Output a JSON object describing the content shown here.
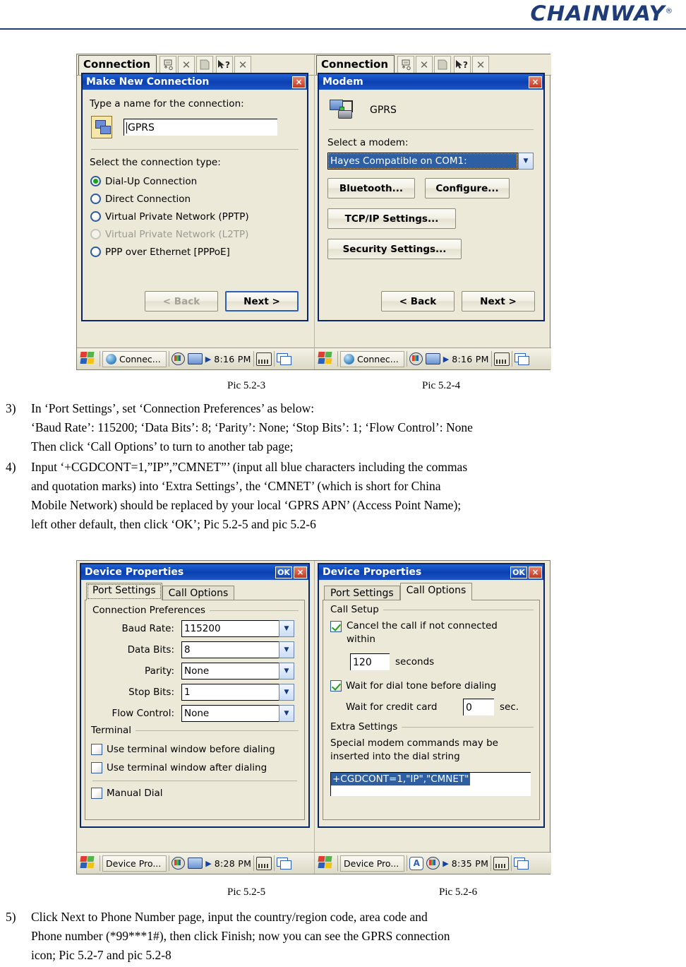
{
  "header": {
    "brand": "CHAINWAY",
    "registered": "®"
  },
  "figures": {
    "top": {
      "left": {
        "shell": {
          "title": "Connection",
          "buttons": [
            "upload-icon",
            "delete-icon",
            "properties-icon",
            "help-icon",
            "close-icon"
          ]
        },
        "dialog": {
          "title": "Make New Connection",
          "close_label": "×",
          "name_prompt": "Type a name for the connection:",
          "name_value": "GPRS",
          "type_prompt": "Select the connection type:",
          "options": [
            {
              "label": "Dial-Up Connection",
              "selected": true,
              "disabled": false
            },
            {
              "label": "Direct Connection",
              "selected": false,
              "disabled": false
            },
            {
              "label": "Virtual Private Network (PPTP)",
              "selected": false,
              "disabled": false
            },
            {
              "label": "Virtual Private Network (L2TP)",
              "selected": false,
              "disabled": true
            },
            {
              "label": "PPP over Ethernet [PPPoE]",
              "selected": false,
              "disabled": false
            }
          ],
          "back_label": "< Back",
          "next_label": "Next >"
        },
        "taskbar": {
          "item": "Connec...",
          "time": "8:16 PM"
        }
      },
      "right": {
        "shell": {
          "title": "Connection",
          "buttons": [
            "upload-icon",
            "delete-icon",
            "properties-icon",
            "help-icon",
            "close-icon"
          ]
        },
        "dialog": {
          "title": "Modem",
          "close_label": "×",
          "connection_name": "GPRS",
          "modem_prompt": "Select a modem:",
          "modem_value": "Hayes Compatible on COM1:",
          "bluetooth_label": "Bluetooth...",
          "configure_label": "Configure...",
          "tcpip_label": "TCP/IP Settings...",
          "security_label": "Security Settings...",
          "back_label": "< Back",
          "next_label": "Next >"
        },
        "taskbar": {
          "item": "Connec...",
          "time": "8:16 PM"
        }
      },
      "caption_left": "Pic 5.2-3",
      "caption_right": "Pic 5.2-4"
    },
    "bottom": {
      "left": {
        "dialog": {
          "title": "Device Properties",
          "ok_label": "OK",
          "close_label": "×",
          "tabs": [
            {
              "label": "Port Settings",
              "active": true
            },
            {
              "label": "Call Options",
              "active": false
            }
          ],
          "group_label": "Connection Preferences",
          "fields": [
            {
              "label": "Baud Rate:",
              "value": "115200"
            },
            {
              "label": "Data Bits:",
              "value": "8"
            },
            {
              "label": "Parity:",
              "value": "None"
            },
            {
              "label": "Stop Bits:",
              "value": "1"
            },
            {
              "label": "Flow Control:",
              "value": "None"
            }
          ],
          "terminal_label": "Terminal",
          "checks": [
            {
              "label": "Use terminal window before dialing",
              "checked": false
            },
            {
              "label": "Use terminal window after dialing",
              "checked": false
            },
            {
              "label": "Manual Dial",
              "checked": false
            }
          ]
        },
        "taskbar": {
          "item": "Device Pro...",
          "time": "8:28 PM"
        }
      },
      "right": {
        "dialog": {
          "title": "Device Properties",
          "ok_label": "OK",
          "close_label": "×",
          "tabs": [
            {
              "label": "Port Settings",
              "active": false
            },
            {
              "label": "Call Options",
              "active": true
            }
          ],
          "call_setup_label": "Call Setup",
          "cancel_check": {
            "label": "Cancel the call if not connected within",
            "checked": true
          },
          "timeout_value": "120",
          "timeout_unit": "seconds",
          "dialtone_check": {
            "label": "Wait for dial tone before dialing",
            "checked": true
          },
          "credit_label": "Wait for credit card",
          "credit_value": "0",
          "credit_unit": "sec.",
          "extra_settings_label": "Extra Settings",
          "extra_hint": "Special modem commands may be inserted into the dial string",
          "extra_value": "+CGDCONT=1,\"IP\",\"CMNET\""
        },
        "taskbar": {
          "item": "Device Pro...",
          "time": "8:35 PM",
          "ime_badge": "A"
        }
      },
      "caption_left": "Pic 5.2-5",
      "caption_right": "Pic 5.2-6"
    }
  },
  "body": {
    "step3": {
      "num": "3)",
      "line1": "In ‘Port Settings’, set ‘Connection Preferences’ as below:",
      "line2": "‘Baud Rate’: 115200; ‘Data Bits’: 8; ‘Parity’: None; ‘Stop Bits’: 1; ‘Flow Control’: None",
      "line3": "Then click ‘Call Options’ to turn to another tab page;"
    },
    "step4": {
      "num": "4)",
      "line1": "Input ‘+CGDCONT=1,”IP”,”CMNET”’ (input all blue characters including the commas",
      "line2": "and quotation marks) into ‘Extra Settings’, the ‘CMNET’ (which is short for China",
      "line3": "Mobile Network) should be replaced by your local ‘GPRS APN’ (Access Point Name);",
      "line4": "left other default, then click ‘OK’; Pic 5.2-5 and pic 5.2-6"
    },
    "step5": {
      "num": "5)",
      "line1": "Click Next to Phone Number page, input the country/region code, area code and",
      "line2": "Phone number (*99***1#), then click Finish; now you can see the GPRS connection",
      "line3": "icon; Pic 5.2-7 and pic 5.2-8"
    }
  }
}
